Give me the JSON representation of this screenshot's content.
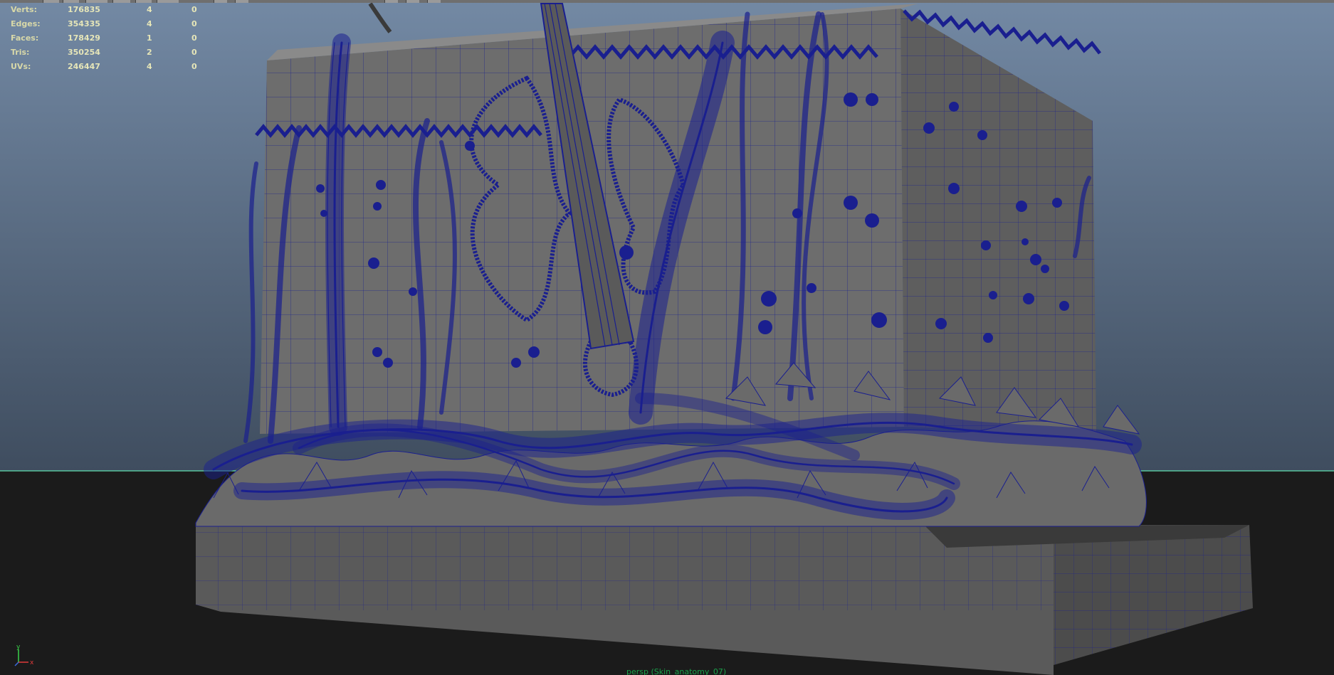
{
  "viewport": {
    "camera_label": "persp (Skin_anatomy_07)",
    "horizon_color": "#5fe0b0",
    "wire_color": "#1a1f8f",
    "background_top": "#7389a4",
    "background_bottom": "#3f4d5f",
    "ground_color": "#1b1b1b"
  },
  "hud": {
    "rows": [
      {
        "label": "Verts:",
        "total": "176835",
        "selected": "4",
        "component": "0"
      },
      {
        "label": "Edges:",
        "total": "354335",
        "selected": "4",
        "component": "0"
      },
      {
        "label": "Faces:",
        "total": "178429",
        "selected": "1",
        "component": "0"
      },
      {
        "label": "Tris:",
        "total": "350254",
        "selected": "2",
        "component": "0"
      },
      {
        "label": "UVs:",
        "total": "246447",
        "selected": "4",
        "component": "0"
      }
    ]
  },
  "axis": {
    "y": "y",
    "x": "x"
  }
}
